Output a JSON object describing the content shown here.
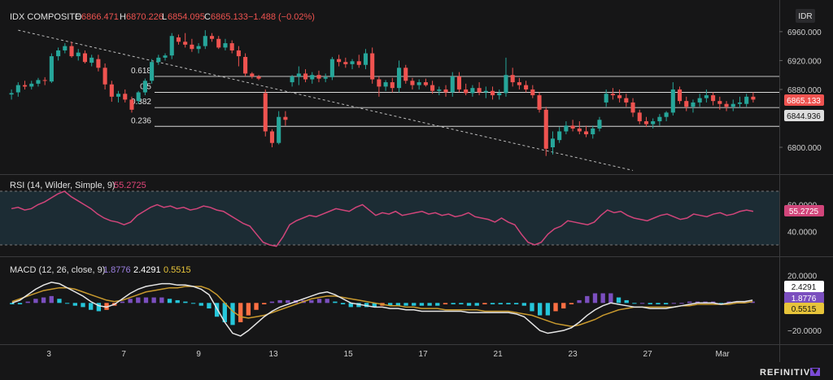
{
  "chart_data": [
    {
      "type": "candlestick",
      "name": "main",
      "header": {
        "symbol": "IDX COMPOSITE",
        "o_label": "O",
        "o_value": "6866.471",
        "h_label": "H",
        "h_value": "6870.226",
        "l_label": "L",
        "l_value": "6854.095",
        "c_label": "C",
        "c_value": "6865.133",
        "change": "−1.488 (−0.02%)"
      },
      "currency": "IDR",
      "yticks": [
        "6960.000",
        "6920.000",
        "6880.000",
        "6800.000"
      ],
      "ylim": [
        6773,
        6970
      ],
      "last_price": "6865.133",
      "mid_price": "6844.936",
      "fib_levels": [
        {
          "label": "0.618",
          "value": 6898
        },
        {
          "label": "0.5",
          "value": 6876
        },
        {
          "label": "0.382",
          "value": 6855
        },
        {
          "label": "0.236",
          "value": 6829
        }
      ],
      "trendline": {
        "from": [
          1,
          6962
        ],
        "to": [
          93,
          6768
        ]
      },
      "candles": [
        [
          6873,
          6880,
          6866,
          6875
        ],
        [
          6876,
          6890,
          6870,
          6886
        ],
        [
          6886,
          6892,
          6880,
          6884
        ],
        [
          6884,
          6892,
          6880,
          6888
        ],
        [
          6888,
          6896,
          6884,
          6893
        ],
        [
          6893,
          6897,
          6886,
          6892
        ],
        [
          6891,
          6930,
          6889,
          6926
        ],
        [
          6926,
          6938,
          6920,
          6934
        ],
        [
          6934,
          6944,
          6930,
          6940
        ],
        [
          6940,
          6946,
          6924,
          6926
        ],
        [
          6926,
          6936,
          6920,
          6931
        ],
        [
          6930,
          6934,
          6916,
          6918
        ],
        [
          6917,
          6928,
          6912,
          6924
        ],
        [
          6922,
          6928,
          6905,
          6910
        ],
        [
          6910,
          6916,
          6880,
          6887
        ],
        [
          6887,
          6892,
          6863,
          6870
        ],
        [
          6870,
          6878,
          6862,
          6874
        ],
        [
          6874,
          6880,
          6862,
          6866
        ],
        [
          6866,
          6870,
          6848,
          6852
        ],
        [
          6864,
          6878,
          6860,
          6876
        ],
        [
          6876,
          6895,
          6872,
          6892
        ],
        [
          6892,
          6922,
          6888,
          6918
        ],
        [
          6918,
          6928,
          6914,
          6924
        ],
        [
          6924,
          6930,
          6920,
          6927
        ],
        [
          6927,
          6958,
          6922,
          6954
        ],
        [
          6952,
          6956,
          6942,
          6946
        ],
        [
          6946,
          6958,
          6938,
          6942
        ],
        [
          6942,
          6950,
          6932,
          6936
        ],
        [
          6936,
          6944,
          6930,
          6940
        ],
        [
          6940,
          6962,
          6936,
          6954
        ],
        [
          6954,
          6958,
          6946,
          6950
        ],
        [
          6950,
          6954,
          6936,
          6938
        ],
        [
          6938,
          6950,
          6934,
          6944
        ],
        [
          6944,
          6948,
          6930,
          6934
        ],
        [
          6934,
          6940,
          6912,
          6926
        ],
        [
          6925,
          6930,
          6898,
          6902
        ],
        [
          6902,
          6904,
          6895,
          6898
        ],
        [
          6898,
          6900,
          6893,
          6895
        ],
        [
          6875,
          6880,
          6815,
          6822
        ],
        [
          6822,
          6825,
          6800,
          6806
        ],
        [
          6806,
          6850,
          6804,
          6842
        ],
        [
          6842,
          6850,
          6830,
          6838
        ],
        [
          6890,
          6900,
          6884,
          6898
        ],
        [
          6898,
          6912,
          6886,
          6902
        ],
        [
          6902,
          6908,
          6890,
          6894
        ],
        [
          6894,
          6904,
          6888,
          6900
        ],
        [
          6900,
          6906,
          6890,
          6895
        ],
        [
          6895,
          6902,
          6890,
          6897
        ],
        [
          6897,
          6925,
          6893,
          6922
        ],
        [
          6922,
          6928,
          6912,
          6918
        ],
        [
          6918,
          6924,
          6910,
          6915
        ],
        [
          6915,
          6922,
          6908,
          6919
        ],
        [
          6919,
          6928,
          6910,
          6914
        ],
        [
          6914,
          6936,
          6908,
          6930
        ],
        [
          6930,
          6938,
          6888,
          6894
        ],
        [
          6894,
          6898,
          6870,
          6884
        ],
        [
          6884,
          6893,
          6878,
          6890
        ],
        [
          6890,
          6896,
          6876,
          6882
        ],
        [
          6882,
          6920,
          6876,
          6910
        ],
        [
          6910,
          6914,
          6888,
          6892
        ],
        [
          6892,
          6896,
          6880,
          6886
        ],
        [
          6886,
          6894,
          6880,
          6890
        ],
        [
          6890,
          6895,
          6884,
          6886
        ],
        [
          6886,
          6892,
          6874,
          6878
        ],
        [
          6878,
          6884,
          6872,
          6880
        ],
        [
          6880,
          6886,
          6870,
          6876
        ],
        [
          6876,
          6904,
          6870,
          6898
        ],
        [
          6898,
          6904,
          6876,
          6880
        ],
        [
          6880,
          6888,
          6872,
          6875
        ],
        [
          6875,
          6886,
          6870,
          6882
        ],
        [
          6882,
          6890,
          6872,
          6876
        ],
        [
          6876,
          6884,
          6868,
          6878
        ],
        [
          6878,
          6884,
          6866,
          6872
        ],
        [
          6872,
          6880,
          6866,
          6875
        ],
        [
          6875,
          6924,
          6870,
          6900
        ],
        [
          6900,
          6910,
          6884,
          6890
        ],
        [
          6890,
          6896,
          6880,
          6886
        ],
        [
          6886,
          6892,
          6876,
          6880
        ],
        [
          6880,
          6886,
          6868,
          6872
        ],
        [
          6872,
          6876,
          6848,
          6852
        ],
        [
          6852,
          6856,
          6788,
          6798
        ],
        [
          6800,
          6822,
          6790,
          6812
        ],
        [
          6810,
          6828,
          6806,
          6822
        ],
        [
          6822,
          6836,
          6818,
          6830
        ],
        [
          6830,
          6838,
          6822,
          6826
        ],
        [
          6826,
          6836,
          6818,
          6822
        ],
        [
          6822,
          6830,
          6814,
          6818
        ],
        [
          6818,
          6830,
          6812,
          6826
        ],
        [
          6826,
          6842,
          6822,
          6838
        ],
        [
          6862,
          6880,
          6856,
          6874
        ],
        [
          6874,
          6882,
          6866,
          6872
        ],
        [
          6872,
          6880,
          6862,
          6868
        ],
        [
          6868,
          6874,
          6856,
          6862
        ],
        [
          6862,
          6868,
          6842,
          6848
        ],
        [
          6848,
          6852,
          6832,
          6836
        ],
        [
          6836,
          6842,
          6828,
          6832
        ],
        [
          6832,
          6840,
          6826,
          6836
        ],
        [
          6836,
          6846,
          6830,
          6842
        ],
        [
          6842,
          6850,
          6836,
          6848
        ],
        [
          6848,
          6890,
          6844,
          6880
        ],
        [
          6880,
          6884,
          6860,
          6864
        ],
        [
          6864,
          6870,
          6850,
          6856
        ],
        [
          6856,
          6866,
          6848,
          6862
        ],
        [
          6862,
          6874,
          6856,
          6868
        ],
        [
          6868,
          6880,
          6862,
          6872
        ],
        [
          6872,
          6876,
          6858,
          6864
        ],
        [
          6864,
          6870,
          6852,
          6860
        ],
        [
          6860,
          6864,
          6850,
          6856
        ],
        [
          6856,
          6866,
          6850,
          6860
        ],
        [
          6860,
          6870,
          6854,
          6862
        ],
        [
          6860,
          6874,
          6856,
          6870
        ],
        [
          6870,
          6876,
          6862,
          6866
        ]
      ]
    },
    {
      "type": "line",
      "name": "rsi",
      "title": "RSI (14, Wilder, Simple, 9)",
      "value_label": "55.2725",
      "yticks": [
        "60.0000",
        "40.0000"
      ],
      "ylim": [
        28,
        72
      ],
      "band": [
        70,
        30
      ],
      "values": [
        57,
        58,
        56,
        57,
        60,
        62,
        65,
        68,
        70,
        66,
        63,
        60,
        57,
        53,
        50,
        48,
        47,
        45,
        47,
        52,
        55,
        58,
        60,
        58,
        59,
        57,
        58,
        56,
        57,
        59,
        58,
        56,
        55,
        52,
        49,
        46,
        44,
        38,
        32,
        30,
        29,
        36,
        45,
        48,
        50,
        52,
        51,
        53,
        55,
        57,
        56,
        55,
        58,
        60,
        56,
        52,
        54,
        53,
        55,
        52,
        53,
        54,
        55,
        53,
        54,
        52,
        53,
        51,
        52,
        54,
        51,
        50,
        49,
        47,
        50,
        47,
        45,
        38,
        32,
        30,
        32,
        38,
        42,
        44,
        48,
        47,
        46,
        45,
        47,
        52,
        56,
        54,
        55,
        52,
        50,
        49,
        48,
        50,
        52,
        53,
        51,
        49,
        50,
        53,
        52,
        51,
        53,
        54,
        52,
        53,
        55,
        56,
        55
      ]
    },
    {
      "type": "line",
      "name": "macd",
      "title": "MACD (12, 26, close, 9)",
      "macd_value": "1.8776",
      "signal_value": "2.4291",
      "hist_value": "0.5515",
      "yticks": [
        "20.0000",
        "−20.0000"
      ],
      "ylim": [
        -27,
        25
      ],
      "macd": [
        0,
        2,
        6,
        10,
        13,
        15,
        14,
        11,
        8,
        5,
        1,
        -2,
        -3,
        -1,
        3,
        7,
        10,
        12,
        13,
        14,
        14,
        13,
        13,
        12,
        10,
        6,
        -4,
        -14,
        -22,
        -24,
        -20,
        -15,
        -10,
        -6,
        -3,
        -1,
        1,
        3,
        5,
        7,
        8,
        6,
        3,
        0,
        -1,
        -2,
        -3,
        -3,
        -4,
        -4,
        -5,
        -5,
        -6,
        -6,
        -6,
        -6,
        -6,
        -6,
        -7,
        -7,
        -7,
        -7,
        -7,
        -7,
        -8,
        -10,
        -15,
        -20,
        -22,
        -21,
        -20,
        -18,
        -14,
        -9,
        -5,
        -2,
        0,
        -1,
        -2,
        -3,
        -3,
        -4,
        -4,
        -4,
        -3,
        -2,
        -1,
        0,
        0,
        0,
        -1,
        0,
        1,
        1,
        2
      ],
      "signal": [
        1,
        3,
        5,
        7,
        9,
        10,
        11,
        11,
        10,
        8,
        6,
        4,
        2,
        1,
        2,
        4,
        6,
        8,
        9,
        10,
        11,
        11,
        12,
        12,
        12,
        10,
        6,
        0,
        -6,
        -10,
        -11,
        -10,
        -9,
        -7,
        -5,
        -3,
        -1,
        1,
        3,
        4,
        5,
        5,
        4,
        3,
        2,
        1,
        0,
        -1,
        -2,
        -2,
        -3,
        -3,
        -4,
        -4,
        -4,
        -5,
        -5,
        -5,
        -5,
        -5,
        -6,
        -6,
        -6,
        -6,
        -7,
        -8,
        -9,
        -11,
        -13,
        -15,
        -16,
        -17,
        -16,
        -14,
        -12,
        -9,
        -7,
        -5,
        -4,
        -3,
        -3,
        -3,
        -3,
        -3,
        -3,
        -2,
        -2,
        -1,
        -1,
        -1,
        -1,
        -1,
        0,
        0,
        1
      ]
    }
  ],
  "x_axis": {
    "labels": [
      "3",
      "7",
      "9",
      "13",
      "15",
      "17",
      "21",
      "23",
      "27",
      "Mar"
    ],
    "positions": [
      4,
      12,
      20,
      28,
      36,
      44,
      52,
      60,
      68,
      76
    ]
  },
  "brand": "REFINITIV",
  "colors": {
    "up": "#26a69a",
    "down": "#ef5350",
    "rsi": "#d1457a",
    "macd": "#ffffff",
    "signal": "#c99a2e",
    "hist_up": "#7b4fbf",
    "hist_up2": "#26c6da",
    "hist_down": "#ff7043"
  }
}
